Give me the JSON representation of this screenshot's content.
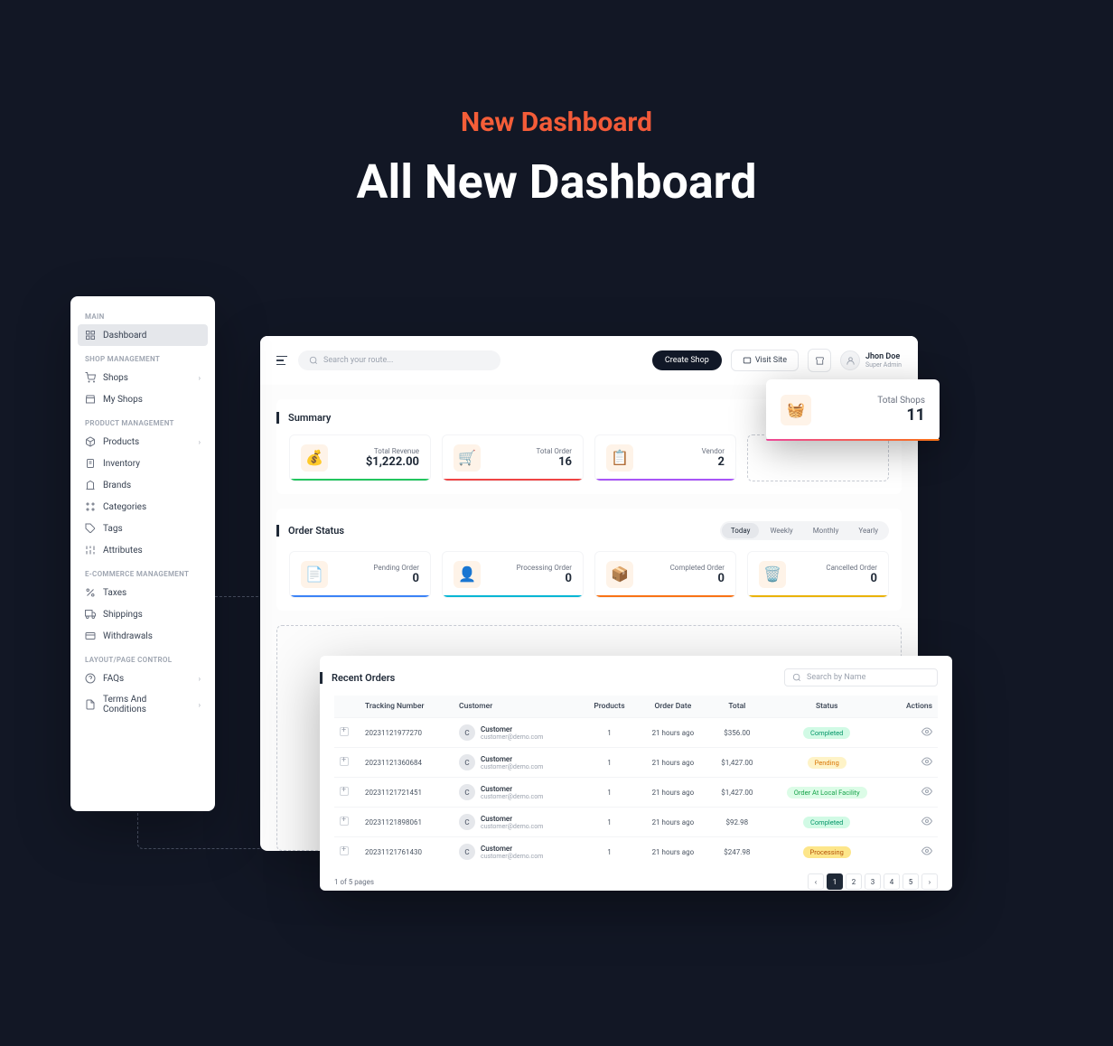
{
  "hero": {
    "tag": "New Dashboard",
    "title": "All New Dashboard"
  },
  "sidebar": {
    "sections": [
      {
        "heading": "MAIN",
        "items": [
          {
            "label": "Dashboard",
            "active": true
          }
        ]
      },
      {
        "heading": "SHOP MANAGEMENT",
        "items": [
          {
            "label": "Shops",
            "chevron": true
          },
          {
            "label": "My Shops"
          }
        ]
      },
      {
        "heading": "PRODUCT MANAGEMENT",
        "items": [
          {
            "label": "Products",
            "chevron": true
          },
          {
            "label": "Inventory"
          },
          {
            "label": "Brands"
          },
          {
            "label": "Categories"
          },
          {
            "label": "Tags"
          },
          {
            "label": "Attributes"
          }
        ]
      },
      {
        "heading": "E-COMMERCE MANAGEMENT",
        "items": [
          {
            "label": "Taxes"
          },
          {
            "label": "Shippings"
          },
          {
            "label": "Withdrawals"
          }
        ]
      },
      {
        "heading": "LAYOUT/PAGE CONTROL",
        "items": [
          {
            "label": "FAQs",
            "chevron": true
          },
          {
            "label": "Terms And Conditions",
            "chevron": true
          }
        ]
      }
    ]
  },
  "topbar": {
    "search_placeholder": "Search your route...",
    "create_shop": "Create Shop",
    "visit_site": "Visit Site",
    "user": {
      "name": "Jhon Doe",
      "role": "Super Admin"
    }
  },
  "summary": {
    "title": "Summary",
    "metrics": [
      {
        "label": "Total Revenue",
        "value": "$1,222.00"
      },
      {
        "label": "Total Order",
        "value": "16"
      },
      {
        "label": "Vendor",
        "value": "2"
      }
    ]
  },
  "float_card": {
    "label": "Total Shops",
    "value": "11"
  },
  "order_status": {
    "title": "Order Status",
    "periods": [
      "Today",
      "Weekly",
      "Monthly",
      "Yearly"
    ],
    "active_period": "Today",
    "metrics": [
      {
        "label": "Pending Order",
        "value": "0"
      },
      {
        "label": "Processing Order",
        "value": "0"
      },
      {
        "label": "Completed Order",
        "value": "0"
      },
      {
        "label": "Cancelled Order",
        "value": "0"
      }
    ]
  },
  "orders": {
    "title": "Recent Orders",
    "search_placeholder": "Search by Name",
    "columns": [
      "Tracking Number",
      "Customer",
      "Products",
      "Order Date",
      "Total",
      "Status",
      "Actions"
    ],
    "rows": [
      {
        "tracking": "20231121977270",
        "customer": "Customer",
        "email": "customer@demo.com",
        "products": "1",
        "date": "21 hours ago",
        "total": "$356.00",
        "status": "Completed",
        "status_class": "b-completed"
      },
      {
        "tracking": "20231121360684",
        "customer": "Customer",
        "email": "customer@demo.com",
        "products": "1",
        "date": "21 hours ago",
        "total": "$1,427.00",
        "status": "Pending",
        "status_class": "b-pending"
      },
      {
        "tracking": "20231121721451",
        "customer": "Customer",
        "email": "customer@demo.com",
        "products": "1",
        "date": "21 hours ago",
        "total": "$1,427.00",
        "status": "Order At Local Facility",
        "status_class": "b-local"
      },
      {
        "tracking": "20231121898061",
        "customer": "Customer",
        "email": "customer@demo.com",
        "products": "1",
        "date": "21 hours ago",
        "total": "$92.98",
        "status": "Completed",
        "status_class": "b-completed"
      },
      {
        "tracking": "20231121761430",
        "customer": "Customer",
        "email": "customer@demo.com",
        "products": "1",
        "date": "21 hours ago",
        "total": "$247.98",
        "status": "Processing",
        "status_class": "b-processing"
      }
    ],
    "page_info": "1 of 5 pages",
    "pages": [
      "1",
      "2",
      "3",
      "4",
      "5"
    ]
  }
}
